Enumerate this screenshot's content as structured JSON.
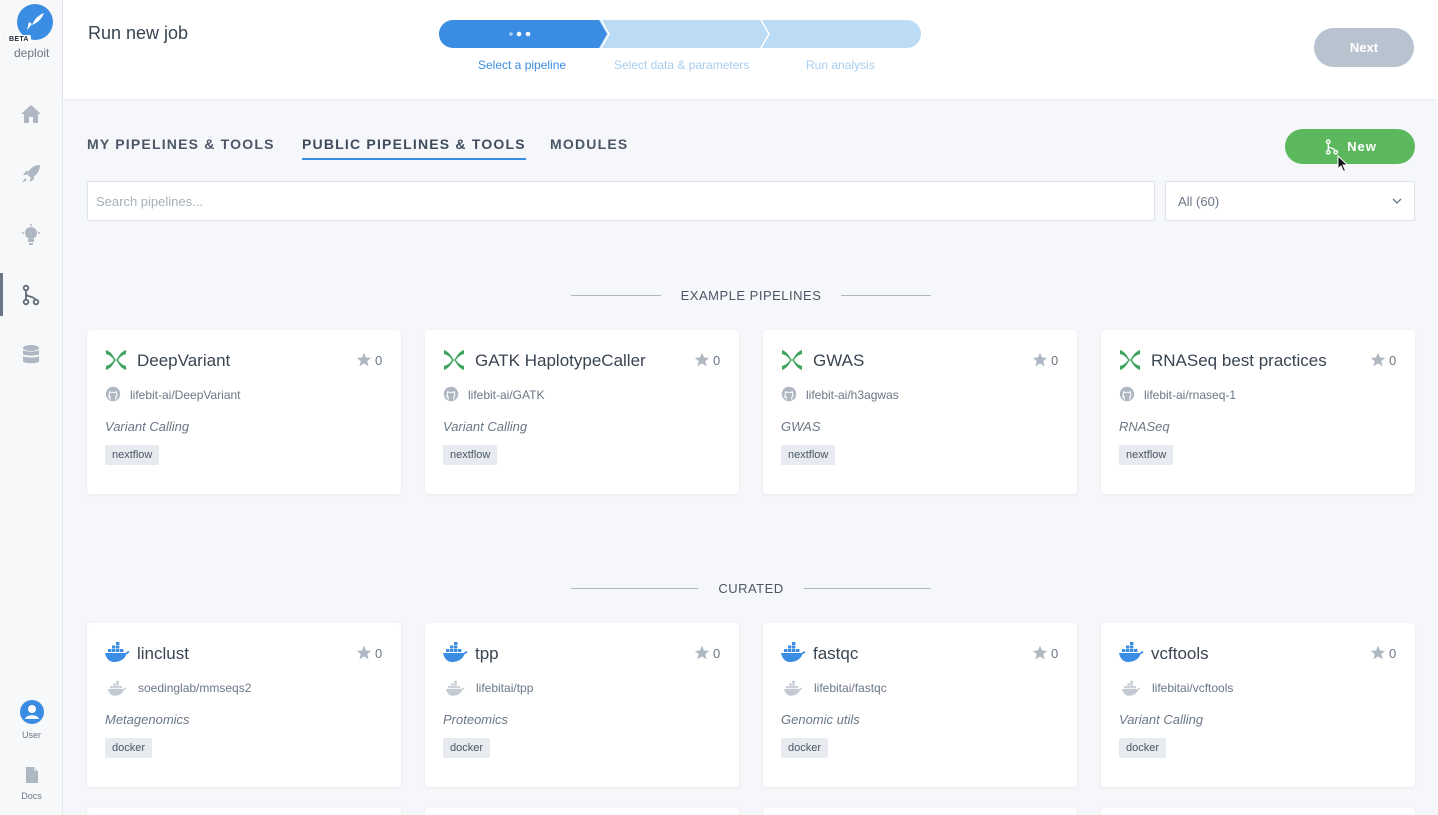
{
  "sidebar": {
    "logo_badge": "BETA",
    "logo_text": "deploit",
    "nav": [
      {
        "icon": "home-icon"
      },
      {
        "icon": "rocket-icon"
      },
      {
        "icon": "lightbulb-icon"
      },
      {
        "icon": "pipelines-icon",
        "active": true
      },
      {
        "icon": "database-icon"
      }
    ],
    "user_label": "User",
    "docs_label": "Docs"
  },
  "header": {
    "title": "Run new job",
    "steps": [
      {
        "label": "Select a pipeline",
        "active": true
      },
      {
        "label": "Select data & parameters",
        "active": false
      },
      {
        "label": "Run analysis",
        "active": false
      }
    ],
    "next_label": "Next"
  },
  "tabs": [
    {
      "label": "MY PIPELINES & TOOLS",
      "active": false
    },
    {
      "label": "PUBLIC PIPELINES & TOOLS",
      "active": true
    },
    {
      "label": "MODULES",
      "active": false
    }
  ],
  "new_button_label": "New",
  "search": {
    "placeholder": "Search pipelines...",
    "value": ""
  },
  "filter": {
    "selected": "All (60)"
  },
  "sections": [
    {
      "title": "EXAMPLE PIPELINES",
      "cards": [
        {
          "icon": "nextflow-icon",
          "title": "DeepVariant",
          "stars": "0",
          "repo_icon": "github-icon",
          "repo": "lifebit-ai/DeepVariant",
          "category": "Variant Calling",
          "tag": "nextflow"
        },
        {
          "icon": "nextflow-icon",
          "title": "GATK HaplotypeCaller",
          "stars": "0",
          "repo_icon": "github-icon",
          "repo": "lifebit-ai/GATK",
          "category": "Variant Calling",
          "tag": "nextflow"
        },
        {
          "icon": "nextflow-icon",
          "title": "GWAS",
          "stars": "0",
          "repo_icon": "github-icon",
          "repo": "lifebit-ai/h3agwas",
          "category": "GWAS",
          "tag": "nextflow"
        },
        {
          "icon": "nextflow-icon",
          "title": "RNASeq best practices",
          "stars": "0",
          "repo_icon": "github-icon",
          "repo": "lifebit-ai/rnaseq-1",
          "category": "RNASeq",
          "tag": "nextflow"
        }
      ]
    },
    {
      "title": "CURATED",
      "cards": [
        {
          "icon": "docker-icon",
          "title": "linclust",
          "stars": "0",
          "repo_icon": "docker-hub-icon",
          "repo": "soedinglab/mmseqs2",
          "category": "Metagenomics",
          "tag": "docker"
        },
        {
          "icon": "docker-icon",
          "title": "tpp",
          "stars": "0",
          "repo_icon": "docker-hub-icon",
          "repo": "lifebitai/tpp",
          "category": "Proteomics",
          "tag": "docker"
        },
        {
          "icon": "docker-icon",
          "title": "fastqc",
          "stars": "0",
          "repo_icon": "docker-hub-icon",
          "repo": "lifebitai/fastqc",
          "category": "Genomic utils",
          "tag": "docker"
        },
        {
          "icon": "docker-icon",
          "title": "vcftools",
          "stars": "0",
          "repo_icon": "docker-hub-icon",
          "repo": "lifebitai/vcftools",
          "category": "Variant Calling",
          "tag": "docker"
        }
      ]
    }
  ],
  "colors": {
    "accent": "#3b8de3",
    "step_inactive": "#bcdcf6",
    "new_button": "#5cb85c",
    "next_disabled": "#b8c3cf",
    "nextflow_green": "#3da35d",
    "docker_blue": "#3b8de3"
  }
}
